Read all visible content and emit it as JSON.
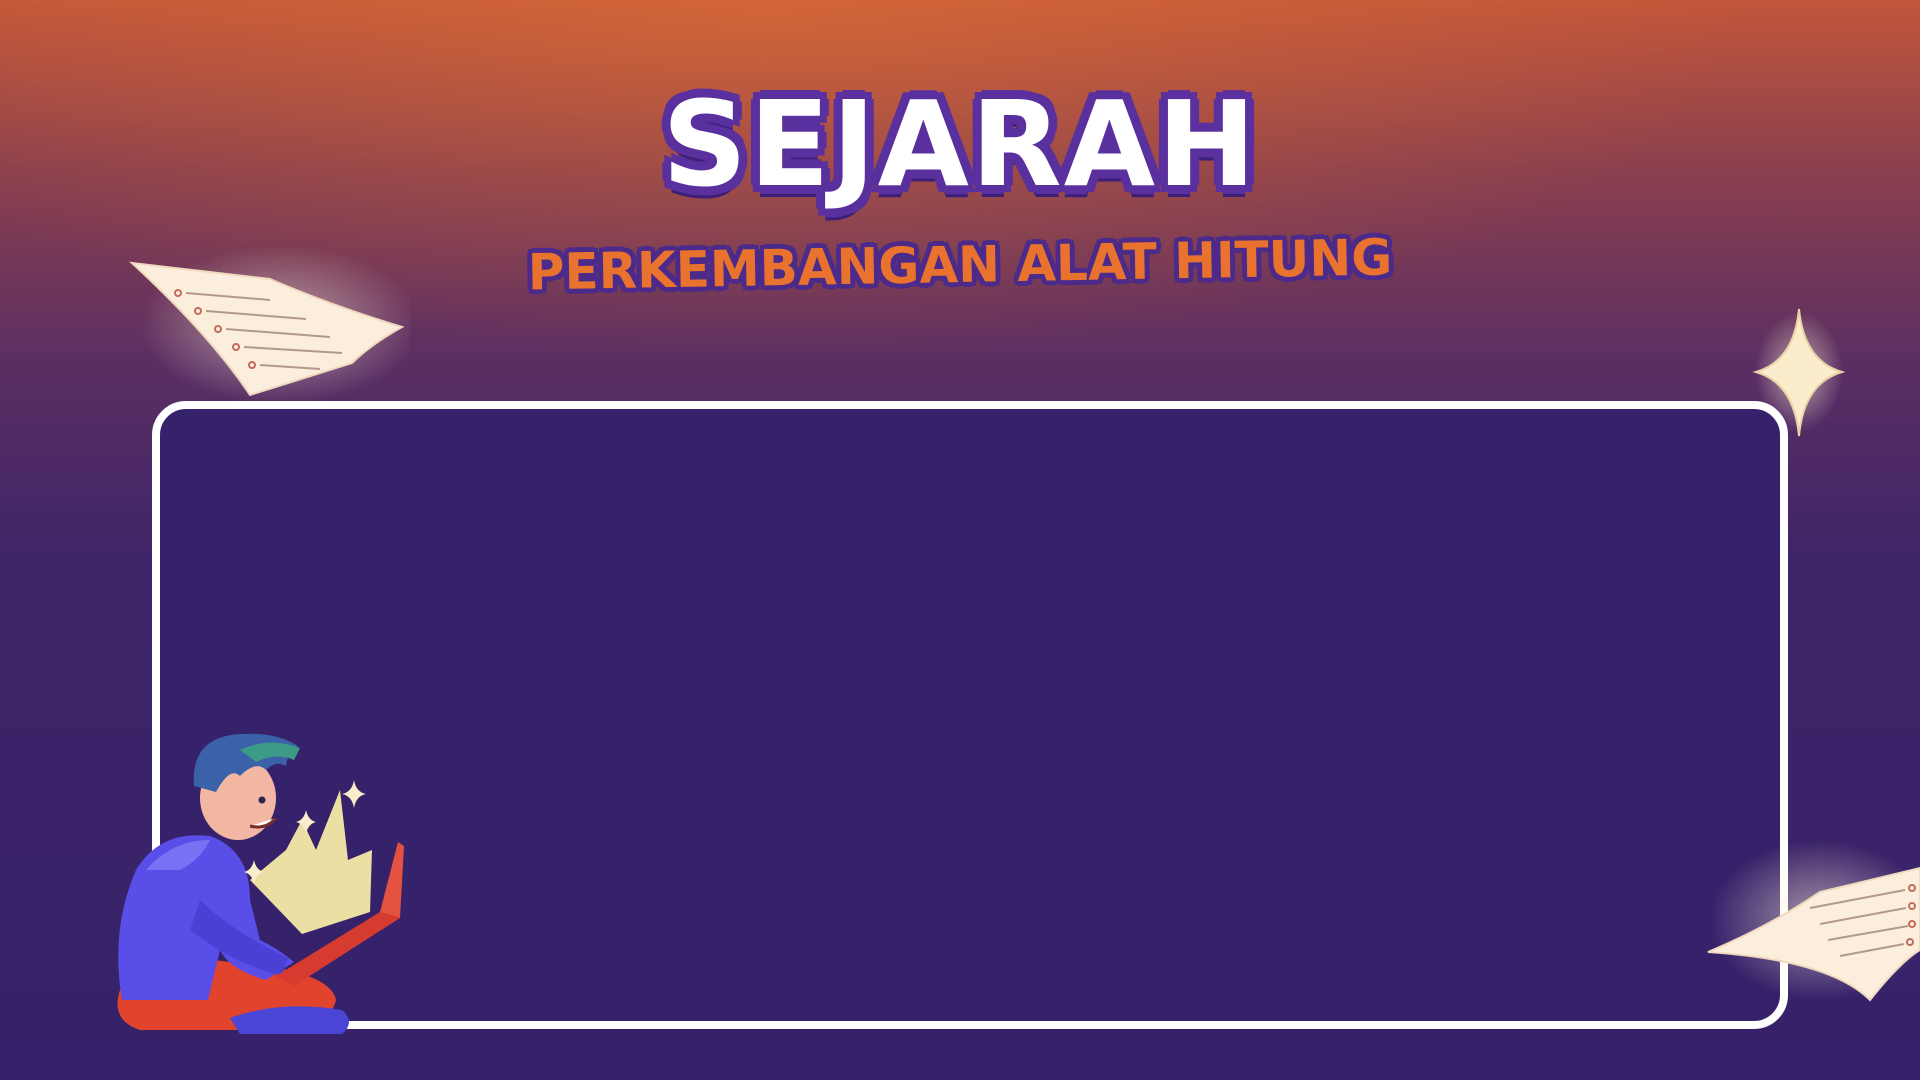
{
  "title": {
    "main": "SEJARAH",
    "subtitle": "PERKEMBANGAN ALAT HITUNG"
  },
  "colors": {
    "background_top": "#c2563a",
    "background_bottom": "#36226a",
    "title_fill": "#ffffff",
    "title_outline": "#5a2f9e",
    "subtitle_fill": "#e8722e",
    "frame_border": "#ffffff",
    "frame_fill": "#36226a"
  },
  "decorations": {
    "top_left": "paper-sheet-icon",
    "bottom_right": "paper-sheet-icon",
    "right": "sparkle-icon",
    "character": "student-with-laptop-illustration"
  }
}
